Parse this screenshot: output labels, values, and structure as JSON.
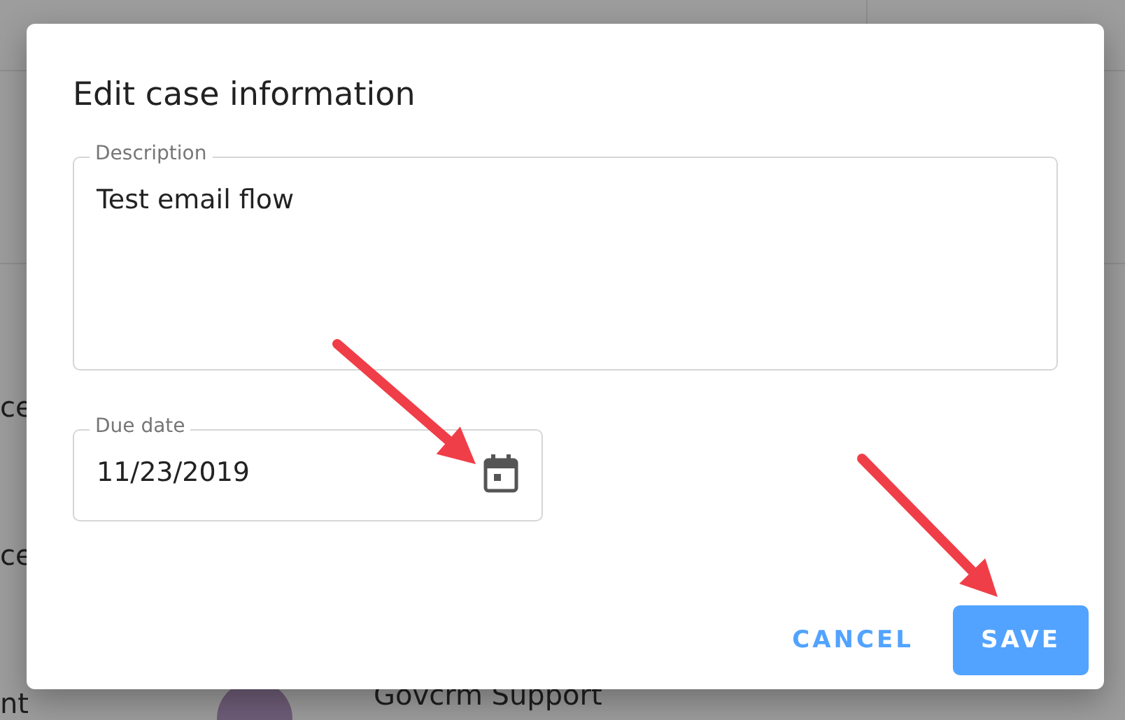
{
  "background": {
    "snippets": [
      "ce",
      "ce",
      "nt"
    ],
    "message": {
      "recipient": "Govcrm Support"
    }
  },
  "dialog": {
    "title": "Edit case information",
    "fields": [
      {
        "kind": "text",
        "label": "Description",
        "value": "Test email flow"
      },
      {
        "kind": "date",
        "label": "Due date",
        "value": "11/23/2019"
      }
    ],
    "buttons": [
      {
        "kind": "text",
        "label": "CANCEL"
      },
      {
        "kind": "contained",
        "label": "SAVE"
      }
    ]
  }
}
